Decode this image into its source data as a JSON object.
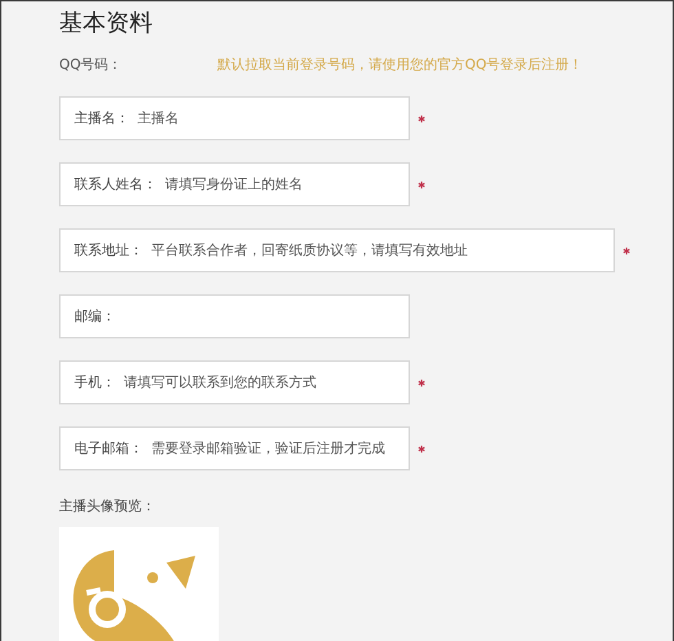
{
  "title": "基本资料",
  "qq": {
    "label": "QQ号码：",
    "notice": "默认拉取当前登录号码，请使用您的官方QQ号登录后注册！"
  },
  "fields": [
    {
      "kind": "narrow",
      "label": "主播名：",
      "placeholder": "主播名",
      "required": true
    },
    {
      "kind": "narrow",
      "label": "联系人姓名：",
      "placeholder": "请填写身份证上的姓名",
      "required": true
    },
    {
      "kind": "wide",
      "label": "联系地址：",
      "placeholder": "平台联系合作者，回寄纸质协议等，请填写有效地址",
      "required": true
    },
    {
      "kind": "narrow",
      "label": "邮编：",
      "required": false
    },
    {
      "kind": "narrow",
      "label": "手机：",
      "placeholder": "请填写可以联系到您的联系方式",
      "required": true
    },
    {
      "kind": "narrow",
      "label": "电子邮箱：",
      "placeholder": "需要登录邮箱验证，验证后注册才完成",
      "required": true
    }
  ],
  "avatar": {
    "label": "主播头像预览："
  }
}
